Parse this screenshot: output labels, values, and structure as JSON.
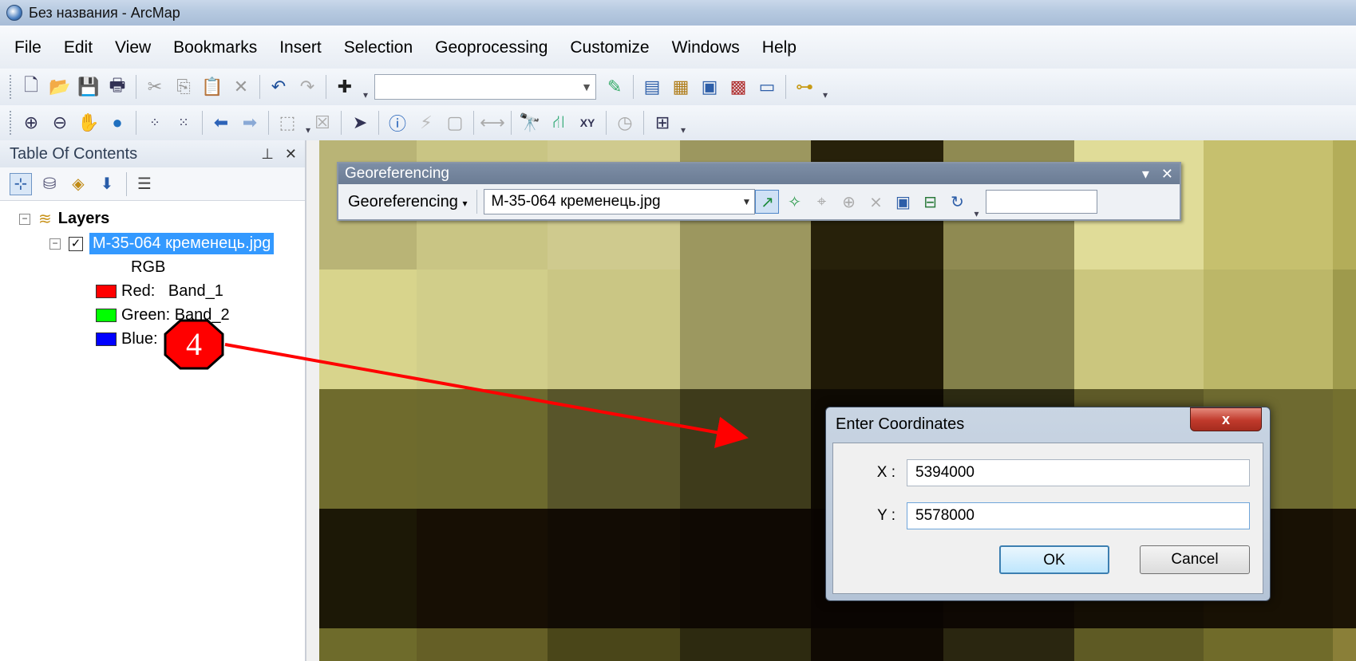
{
  "window": {
    "title": "Без названия - ArcMap"
  },
  "menubar": {
    "items": [
      "File",
      "Edit",
      "View",
      "Bookmarks",
      "Insert",
      "Selection",
      "Geoprocessing",
      "Customize",
      "Windows",
      "Help"
    ]
  },
  "toc": {
    "title": "Table Of Contents",
    "header_buttons": [
      "pin-icon",
      "close-icon"
    ],
    "root_label": "Layers",
    "layer_name": "M-35-064 кременець.jpg",
    "layer_checked": true,
    "renderer": "RGB",
    "bands": [
      {
        "label": "Red:   Band_1",
        "color": "#ff0000"
      },
      {
        "label": "Green: Band_2",
        "color": "#00ff00"
      },
      {
        "label": "Blue:  Band_3",
        "color": "#0000ff"
      }
    ]
  },
  "georef": {
    "title": "Georeferencing",
    "menu_label": "Georeferencing",
    "layer_combo": "M-35-064 кременець.jpg",
    "rms_text": ""
  },
  "dialog": {
    "title": "Enter Coordinates",
    "close_label": "x",
    "x_label": "X :",
    "x_value": "5394000",
    "y_label": "Y :",
    "y_value": "5578000",
    "ok_label": "OK",
    "cancel_label": "Cancel"
  },
  "annotation": {
    "step_number": "4",
    "color": "#ff0000"
  }
}
